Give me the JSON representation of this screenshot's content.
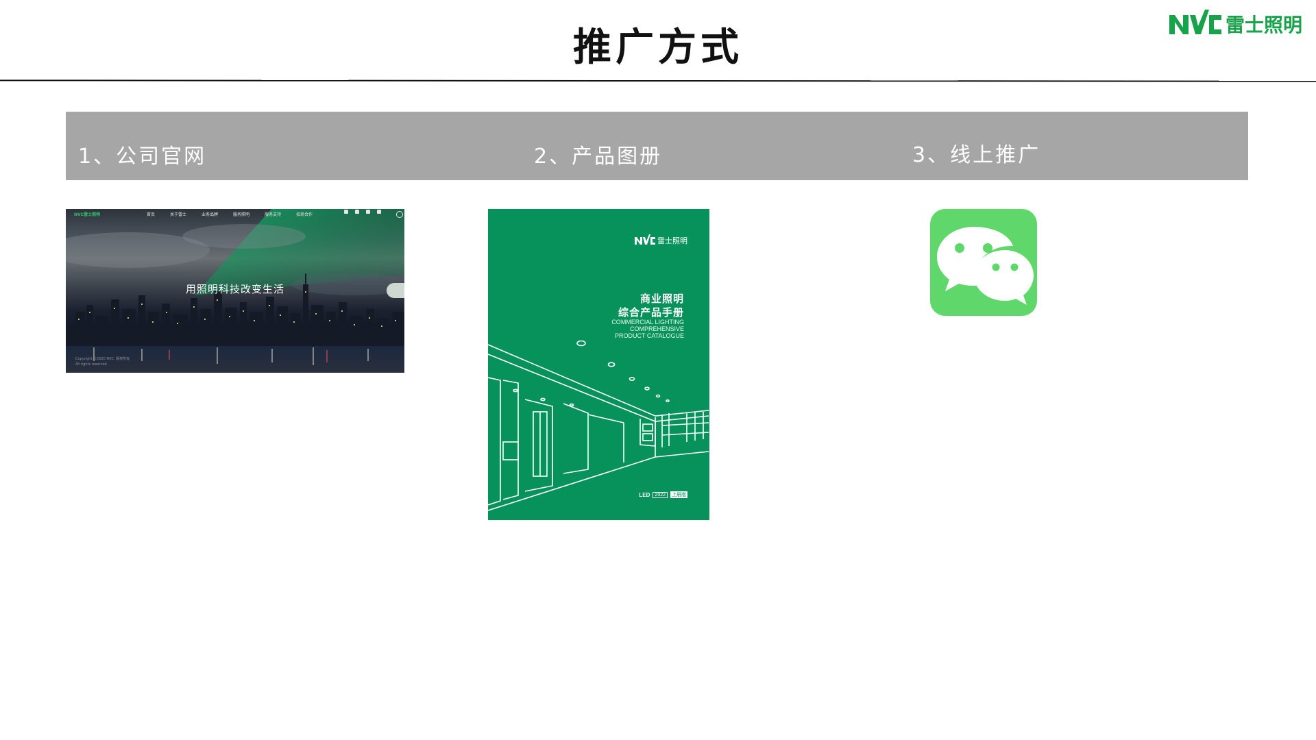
{
  "slide": {
    "title": "推广方式",
    "brand_name": "雷士照明",
    "brand_color": "#17a34a"
  },
  "header_band": {
    "color": "#a6a6a6",
    "labels": [
      "1、公司官网",
      "2、产品图册",
      "3、线上推广"
    ]
  },
  "website": {
    "brand": "NVC雷士照明",
    "nav": [
      "首页",
      "关于雷士",
      "业务品牌",
      "服务照明",
      "服务支持",
      "招商合作"
    ],
    "slogan": "用照明科技改变生活",
    "copyright_lines": [
      "Copyright ©2020 NVC. 版权所有",
      "All rights reserved"
    ]
  },
  "catalogue": {
    "brand": "雷士照明",
    "title_cn": [
      "商业照明",
      "综合产品手册"
    ],
    "title_en": [
      "COMMERCIAL LIGHTING",
      "COMPREHENSIVE",
      "PRODUCT CATALOGUE"
    ],
    "footer": {
      "mark": "LED",
      "year": "2022",
      "edition": "上册版"
    },
    "cover_color": "#06925a"
  },
  "wechat": {
    "icon": "wechat-icon",
    "color": "#5fd76a"
  }
}
